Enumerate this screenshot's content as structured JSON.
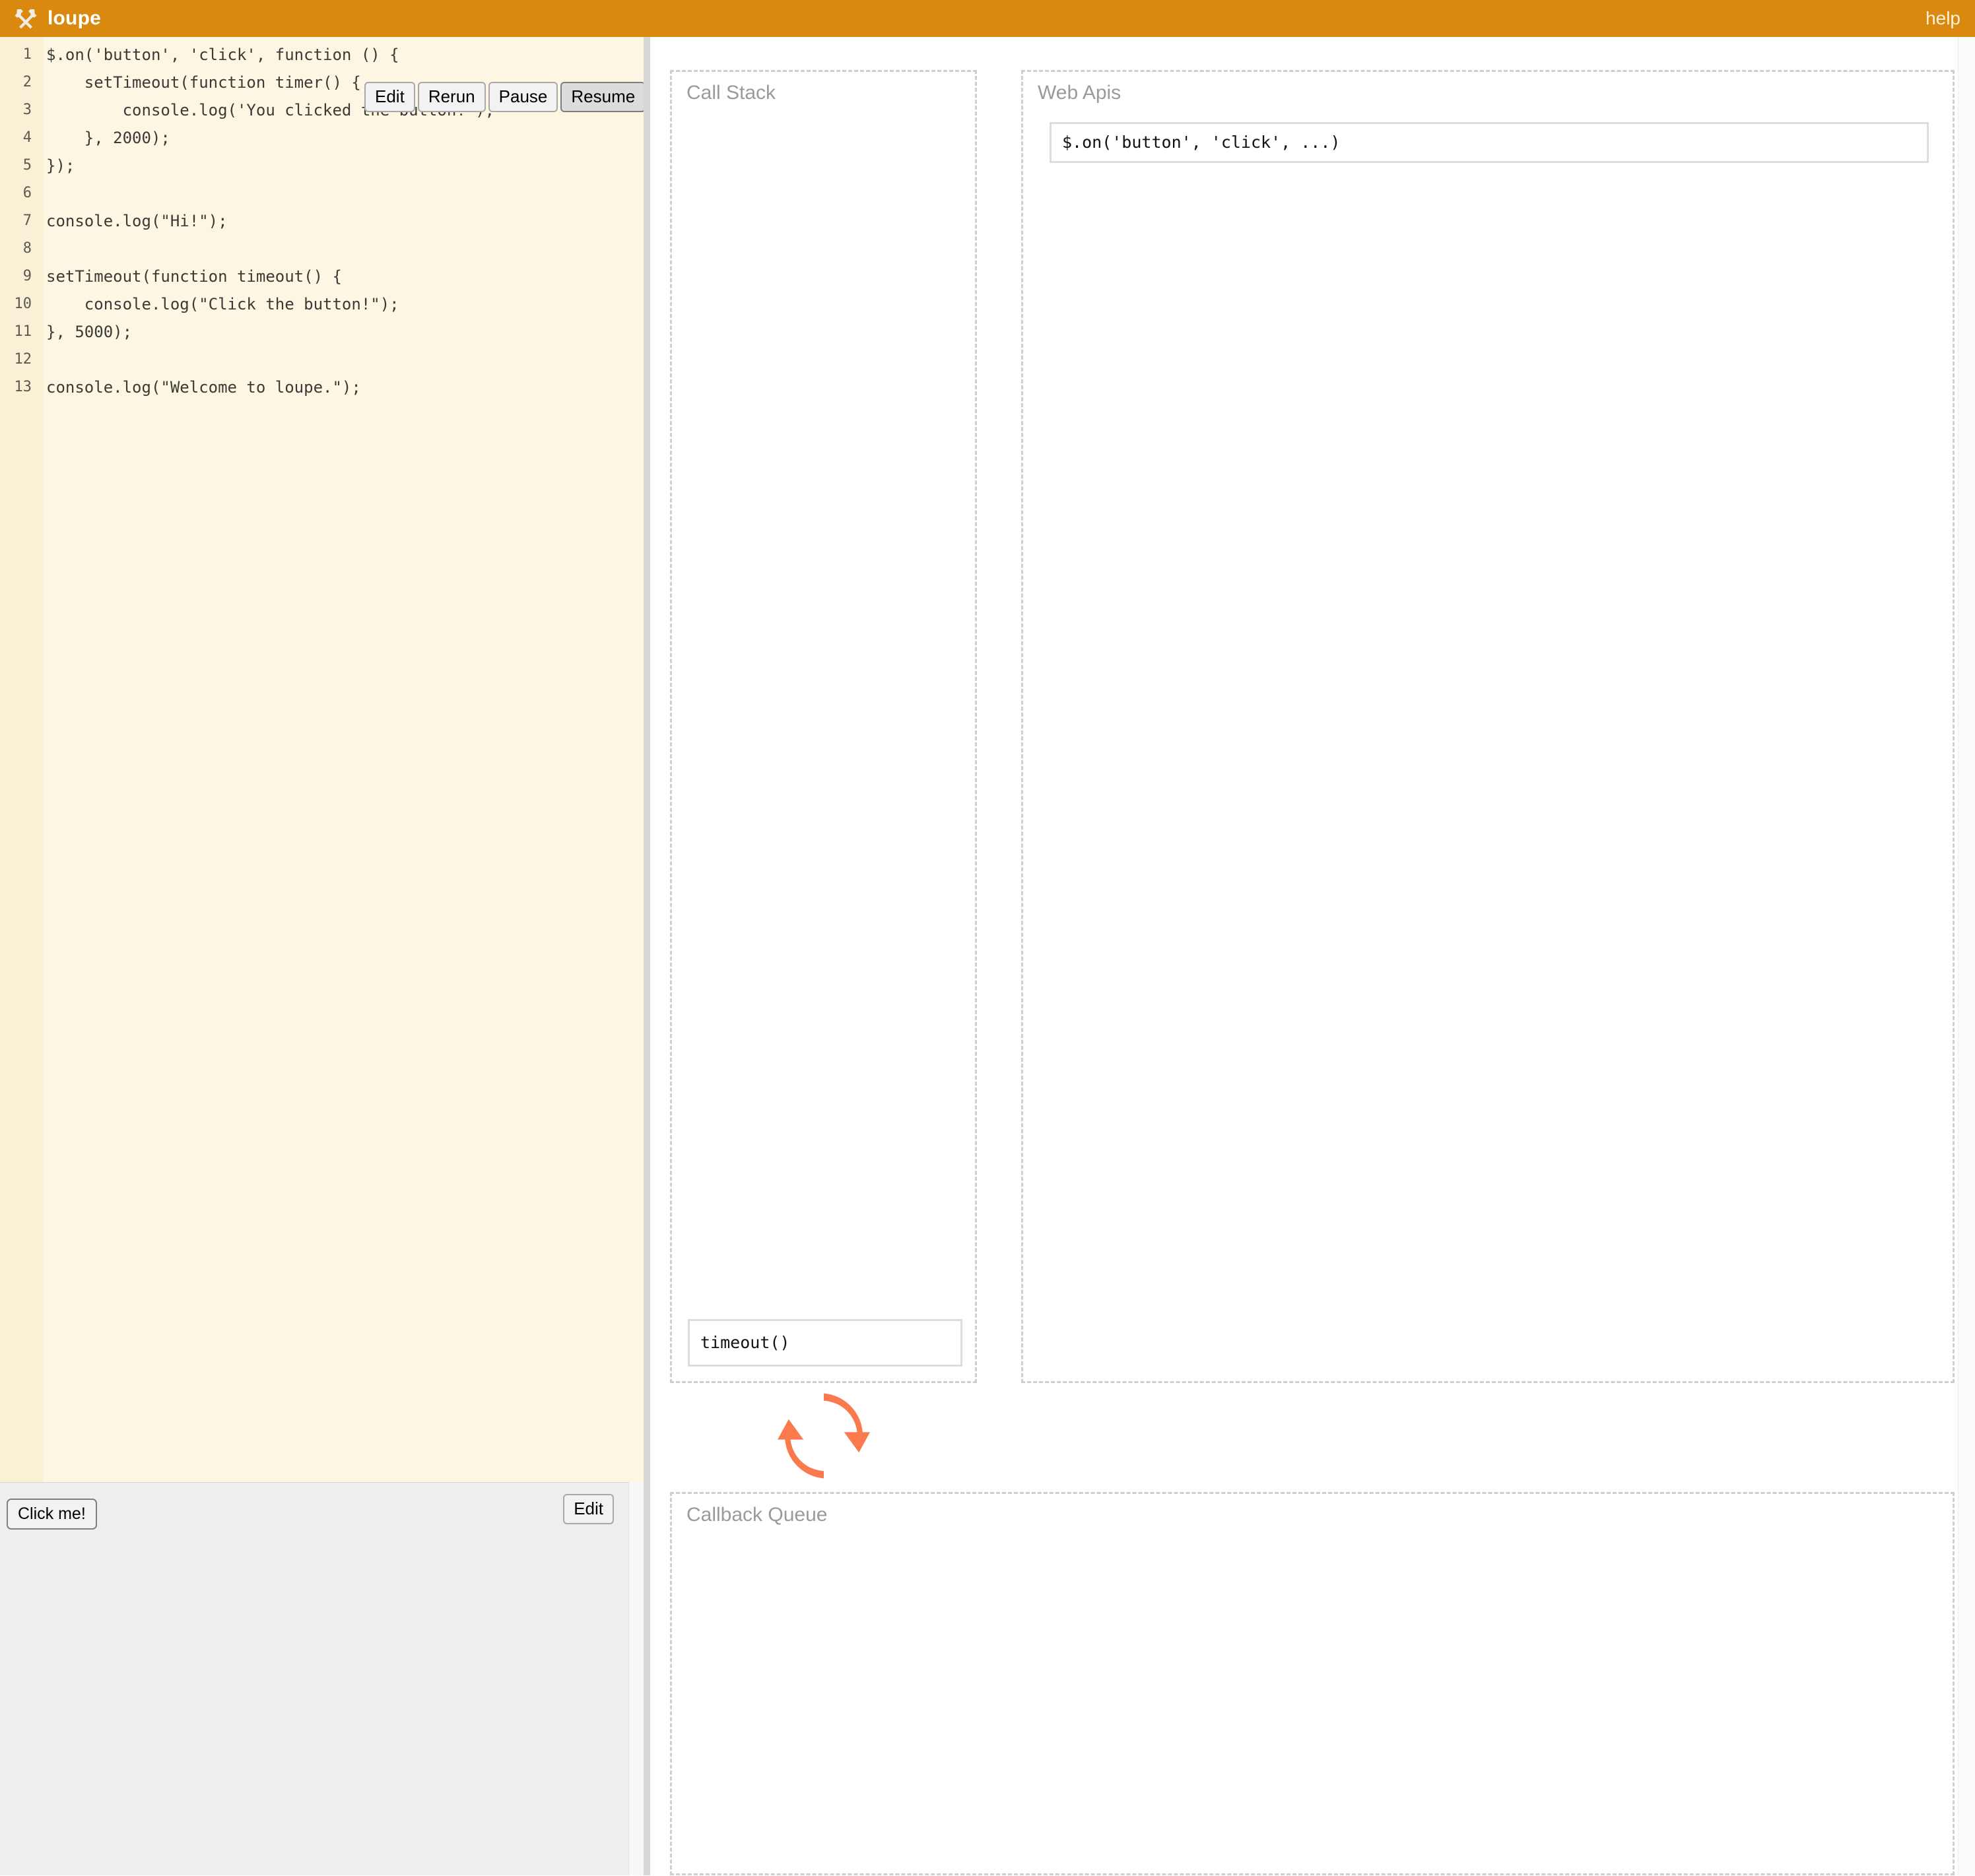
{
  "header": {
    "icon": "crossed-hammers-icon",
    "title": "loupe",
    "help_label": "help",
    "bg_color": "#d98a0e",
    "text_color": "#ffffff"
  },
  "editor": {
    "toolbar": {
      "edit_label": "Edit",
      "rerun_label": "Rerun",
      "pause_label": "Pause",
      "resume_label": "Resume",
      "active_button": "Resume"
    },
    "background_color": "#fdf6e3",
    "gutter_color": "#faf0d5",
    "lines": [
      {
        "n": "1",
        "text": "$.on('button', 'click', function () {"
      },
      {
        "n": "2",
        "text": "    setTimeout(function timer() {"
      },
      {
        "n": "3",
        "text": "        console.log('You clicked the button!');"
      },
      {
        "n": "4",
        "text": "    }, 2000);"
      },
      {
        "n": "5",
        "text": "});"
      },
      {
        "n": "6",
        "text": ""
      },
      {
        "n": "7",
        "text": "console.log(\"Hi!\");"
      },
      {
        "n": "8",
        "text": ""
      },
      {
        "n": "9",
        "text": "setTimeout(function timeout() {"
      },
      {
        "n": "10",
        "text": "    console.log(\"Click the button!\");"
      },
      {
        "n": "11",
        "text": "}, 5000);"
      },
      {
        "n": "12",
        "text": ""
      },
      {
        "n": "13",
        "text": "console.log(\"Welcome to loupe.\");"
      }
    ]
  },
  "console": {
    "click_button_label": "Click me!",
    "edit_label": "Edit",
    "output": "",
    "background_color": "#eeeeee"
  },
  "call_stack": {
    "title": "Call Stack",
    "frames": [
      {
        "label": "timeout()"
      }
    ]
  },
  "web_apis": {
    "title": "Web Apis",
    "items": [
      {
        "label": "$.on('button', 'click', ...)"
      }
    ]
  },
  "callback_queue": {
    "title": "Callback Queue",
    "items": []
  },
  "event_loop": {
    "icon": "circular-refresh-arrows-icon",
    "color": "#fa7a4e"
  }
}
